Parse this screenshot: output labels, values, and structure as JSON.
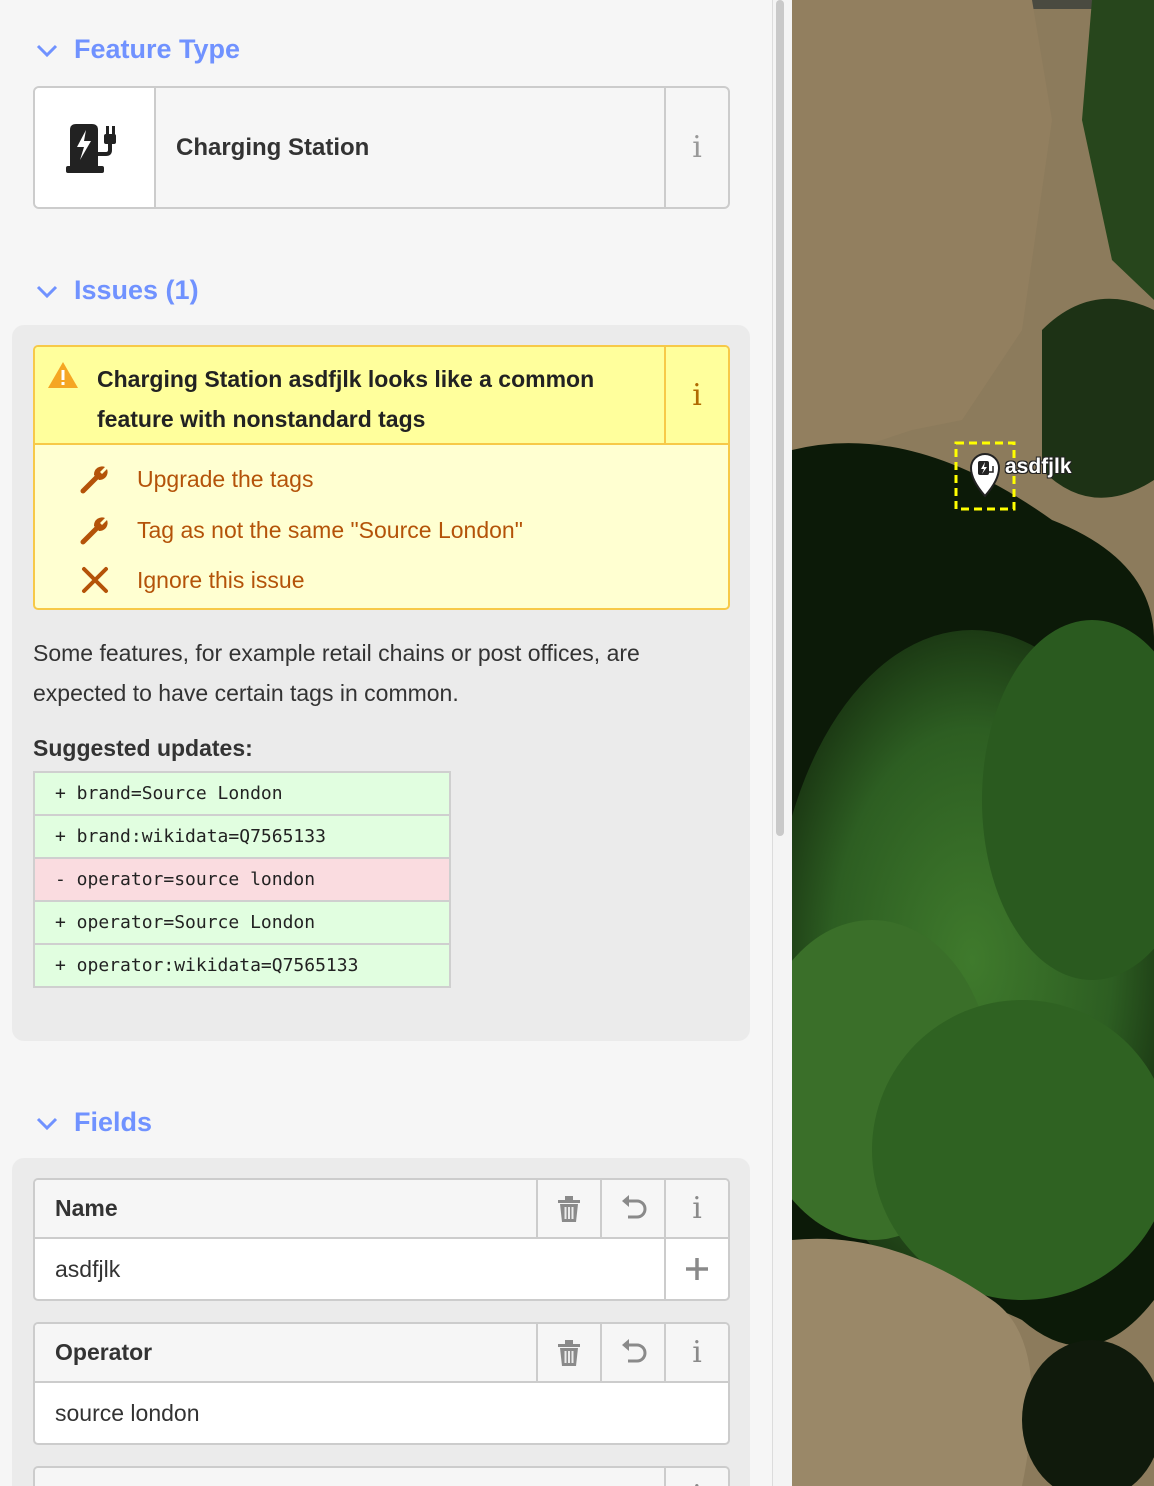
{
  "feature_type": {
    "heading": "Feature Type",
    "preset_name": "Charging Station",
    "preset_icon": "charging-station-icon",
    "info_label": "i"
  },
  "issues": {
    "heading": "Issues (1)",
    "message": "Charging Station asdfjlk looks like a common feature with nonstandard tags",
    "info_label": "i",
    "fixes": [
      {
        "label": "Upgrade the tags",
        "icon": "wrench-icon"
      },
      {
        "label": "Tag as not the same \"Source London\"",
        "icon": "wrench-icon"
      },
      {
        "label": "Ignore this issue",
        "icon": "close-icon"
      }
    ],
    "description": "Some features, for example retail chains or post offices, are expected to have certain tags in common.",
    "suggested_title": "Suggested updates:",
    "suggested_updates": [
      {
        "op": "add",
        "text": "+ brand=Source London"
      },
      {
        "op": "add",
        "text": "+ brand:wikidata=Q7565133"
      },
      {
        "op": "remove",
        "text": "- operator=source london"
      },
      {
        "op": "add",
        "text": "+ operator=Source London"
      },
      {
        "op": "add",
        "text": "+ operator:wikidata=Q7565133"
      }
    ]
  },
  "fields": {
    "heading": "Fields",
    "name_field": {
      "label": "Name",
      "value": "asdfjlk",
      "info_label": "i"
    },
    "operator_field": {
      "label": "Operator",
      "value": "source london",
      "info_label": "i"
    },
    "next_field": {
      "info_label": "i"
    }
  },
  "map": {
    "feature_label": "asdfjlk"
  },
  "colors": {
    "accent": "#7092ff",
    "warning_bg": "#ffff9c",
    "warning_border": "#f7c948",
    "fix_text": "#b45309",
    "diff_add": "#e1fee0",
    "diff_remove": "#fadce0"
  }
}
